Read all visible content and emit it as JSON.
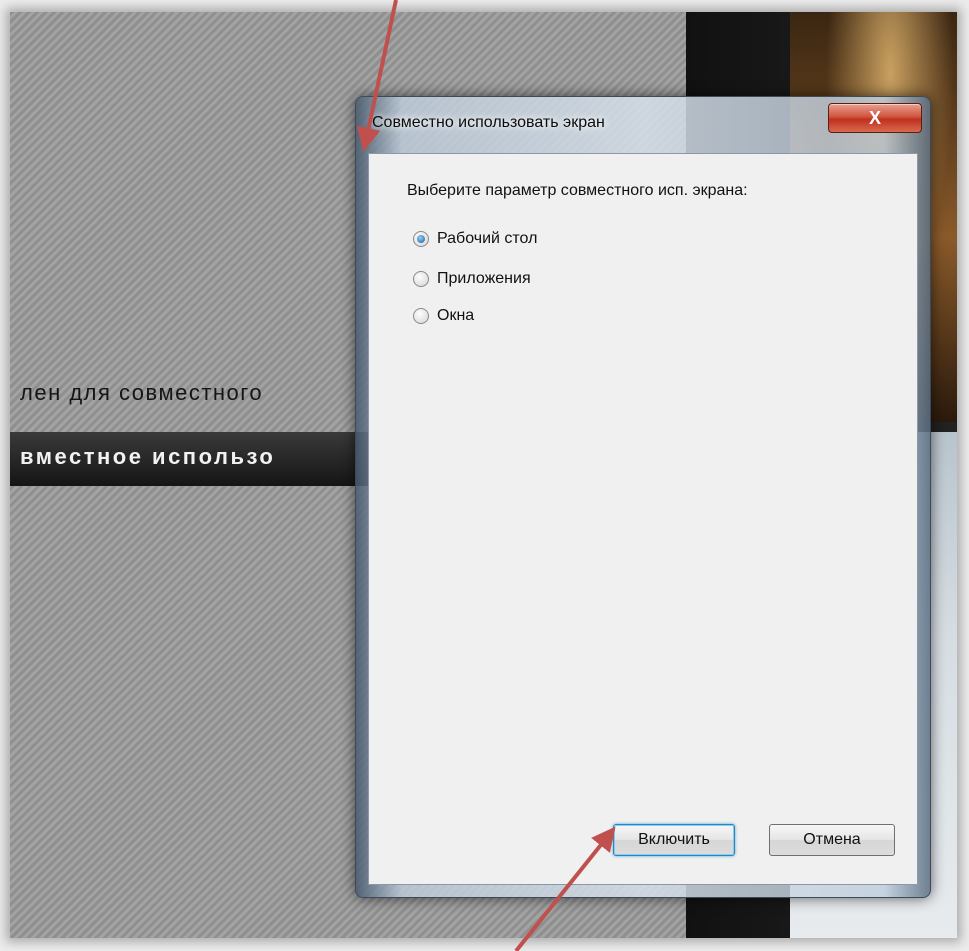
{
  "background": {
    "text_line1": "лен для совместного",
    "text_line2": "вместное использо"
  },
  "dialog": {
    "title": "Совместно использовать экран",
    "close_label": "X",
    "prompt": "Выберите параметр совместного исп. экрана:",
    "options": [
      {
        "label": "Рабочий стол",
        "selected": true
      },
      {
        "label": "Приложения",
        "selected": false
      },
      {
        "label": "Окна",
        "selected": false
      }
    ],
    "buttons": {
      "enable": "Включить",
      "cancel": "Отмена"
    }
  },
  "colors": {
    "annotation_arrow": "#c0504d"
  }
}
